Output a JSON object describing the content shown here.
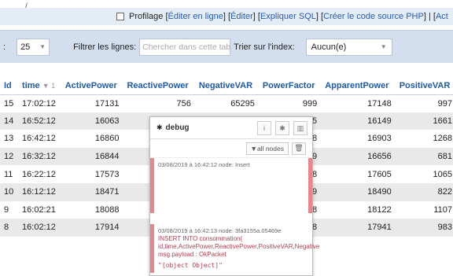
{
  "topbar": {
    "tick": "/",
    "profiling_label": "Profilage [",
    "links": [
      {
        "label": "Éditer en ligne"
      },
      {
        "label": "Éditer"
      },
      {
        "label": "Expliquer SQL"
      },
      {
        "label": "Créer le code source PHP"
      },
      {
        "label": "Act"
      }
    ],
    "separator": "] [",
    "separator_last": "] | ["
  },
  "controls": {
    "colon": ":",
    "rows_value": "25",
    "filter_label": "Filtrer les lignes:",
    "filter_placeholder": "Chercher dans cette tab",
    "sort_label": "Trier sur l'index:",
    "sort_value": "Aucun(e)"
  },
  "table": {
    "headers": [
      "Id",
      "time",
      "ActivePower",
      "ReactivePower",
      "NegativeVAR",
      "PowerFactor",
      "ApparentPower",
      "PositiveVAR"
    ],
    "sort_indicator": "▼ 1",
    "rows": [
      [
        "15",
        "17:02:12",
        "17131",
        "756",
        "65295",
        "999",
        "17148",
        "997"
      ],
      [
        "14",
        "16:52:12",
        "16063",
        "",
        "",
        "95",
        "16149",
        "1661"
      ],
      [
        "13",
        "16:42:12",
        "16860",
        "",
        "",
        "98",
        "16903",
        "1268"
      ],
      [
        "12",
        "16:32:12",
        "16844",
        "",
        "",
        "99",
        "16656",
        "681"
      ],
      [
        "11",
        "16:22:12",
        "17573",
        "",
        "",
        "98",
        "17605",
        "1065"
      ],
      [
        "10",
        "16:12:12",
        "18471",
        "",
        "",
        "99",
        "18490",
        "822"
      ],
      [
        "9",
        "16:02:21",
        "18088",
        "",
        "",
        "98",
        "18122",
        "1107"
      ],
      [
        "8",
        "16:02:12",
        "17914",
        "",
        "",
        "98",
        "17941",
        "983"
      ]
    ]
  },
  "debug": {
    "title": "debug",
    "icons": [
      "info-icon",
      "bug-icon",
      "chart-icon"
    ],
    "all_nodes_label": "▼all nodes",
    "messages": [
      {
        "meta": "03/08/2019 à 16:42:12   node: Insert",
        "lines": []
      },
      {
        "meta": "03/08/2019 à 16:42:13   node: 3fa3155a.05469e",
        "lines": [
          "INSERT INTO consommation(",
          "id,time,ActivePower,ReactivePower,PositiveVAR,Negative",
          "msg.payload : OkPacket"
        ],
        "object": "\"[object Object]\""
      }
    ]
  },
  "colors": {
    "accent": "#1f5aa8",
    "debug_bar": "#e7868d",
    "controls_bg": "#d3dfef"
  }
}
